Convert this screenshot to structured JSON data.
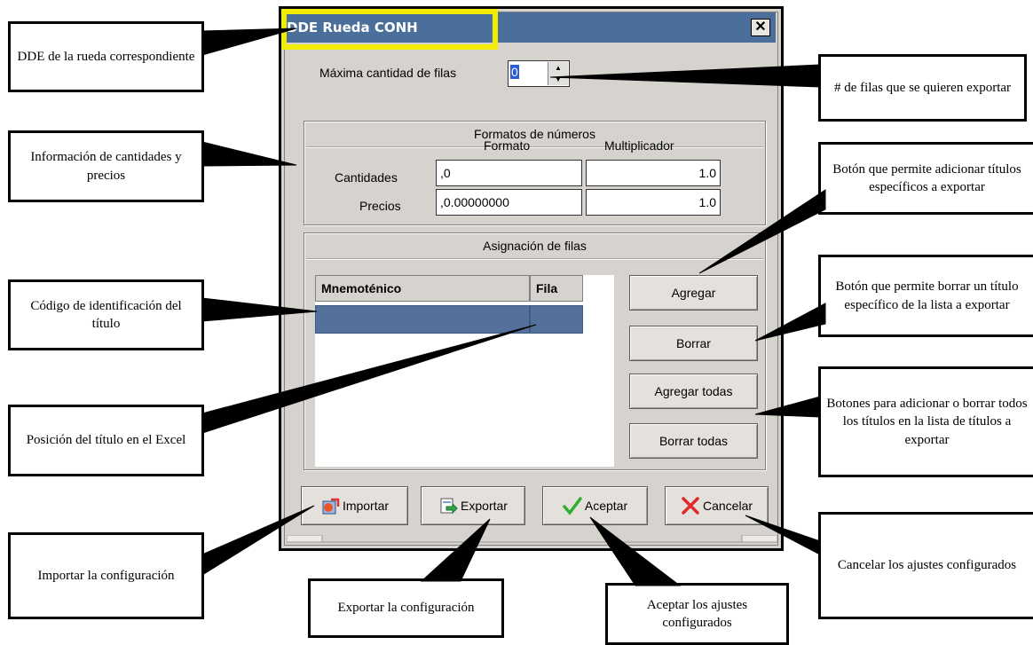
{
  "dialog": {
    "title": "DDE Rueda CONH",
    "close_glyph": "✕",
    "max_rows_label": "Máxima cantidad de filas",
    "max_rows_value": "0",
    "formats": {
      "group_title": "Formatos de números",
      "col_format": "Formato",
      "col_multiplier": "Multiplicador",
      "rows": [
        {
          "label": "Cantidades",
          "format": ",0",
          "multiplier": "1.0"
        },
        {
          "label": "Precios",
          "format": ",0.00000000",
          "multiplier": "1.0"
        }
      ]
    },
    "assignment": {
      "group_title": "Asignación de filas",
      "col_mnemonic": "Mnemoténico",
      "col_row": "Fila",
      "buttons": {
        "add": "Agregar",
        "delete": "Borrar",
        "add_all": "Agregar todas",
        "delete_all": "Borrar todas"
      }
    },
    "footer": {
      "import": "Importar",
      "export": "Exportar",
      "accept": "Aceptar",
      "cancel": "Cancelar"
    }
  },
  "callouts": {
    "dde": "DDE de la rueda correspondiente",
    "rows": "# de filas que se quieren exportar",
    "info": "Información de cantidades y precios",
    "add_btn": "Botón que permite adicionar títulos específicos a exportar",
    "code": "Código de identificación del título",
    "delete_btn": "Botón que permite borrar un título específico de la lista a exportar",
    "all_btns": "Botones para adicionar o borrar todos los títulos en la lista de títulos a exportar",
    "position": "Posición del título en el Excel",
    "import": "Importar la configuración",
    "export": "Exportar la configuración",
    "accept": "Aceptar los ajustes configurados",
    "cancel": "Cancelar los ajustes configurados"
  },
  "colors": {
    "titlebar": "#4a6f9b",
    "highlight": "#f2ec00",
    "dialog_bg": "#d6d3ce",
    "selected_row": "#53719a"
  }
}
